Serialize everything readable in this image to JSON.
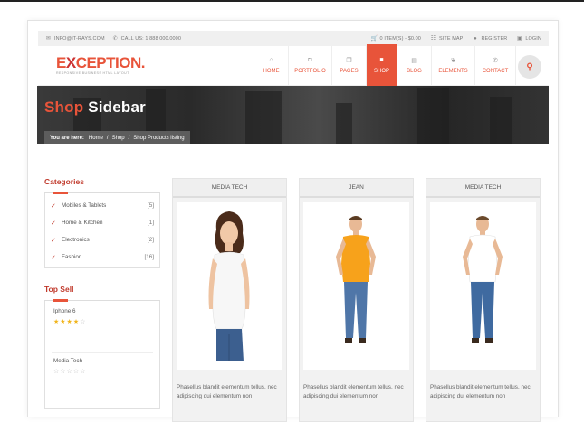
{
  "topbar": {
    "email": "INFO@IT-RAYS.COM",
    "phone": "CALL US: 1 888 000.0000",
    "cart": "0 ITEM(S) - $0.00",
    "sitemap": "SITE MAP",
    "register": "REGISTER",
    "login": "LOGIN"
  },
  "logo": {
    "name_a": "E",
    "name_x": "X",
    "name_b": "CEPTION.",
    "tagline": "RESPONSIVE BUSINESS HTML LAYOUT"
  },
  "nav": [
    {
      "label": "HOME",
      "icon": "home-icon",
      "glyph": "⌂"
    },
    {
      "label": "PORTFOLIO",
      "icon": "camera-icon",
      "glyph": "◘"
    },
    {
      "label": "PAGES",
      "icon": "copy-icon",
      "glyph": "❐"
    },
    {
      "label": "SHOP",
      "icon": "briefcase-icon",
      "glyph": "■"
    },
    {
      "label": "BLOG",
      "icon": "book-icon",
      "glyph": "▤"
    },
    {
      "label": "ELEMENTS",
      "icon": "leaf-icon",
      "glyph": "❦"
    },
    {
      "label": "CONTACT",
      "icon": "phone-icon",
      "glyph": "✆"
    }
  ],
  "hero": {
    "title_a": "Shop",
    "title_b": " Sidebar"
  },
  "breadcrumb": {
    "lead": "You are here:",
    "items": [
      "Home",
      "Shop",
      "Shop Products listing"
    ]
  },
  "categories": {
    "title": "Categories",
    "items": [
      {
        "label": "Mobiles & Tablets",
        "count": "[5]"
      },
      {
        "label": "Home & Kitchen",
        "count": "[1]"
      },
      {
        "label": "Electronics",
        "count": "[2]"
      },
      {
        "label": "Fashion",
        "count": "[16]"
      }
    ]
  },
  "topsell": {
    "title": "Top Sell",
    "items": [
      {
        "name": "Iphone 6",
        "rating": 4
      },
      {
        "name": "Media Tech",
        "rating": 0
      }
    ]
  },
  "products": [
    {
      "category": "MEDIA TECH",
      "desc": "Phasellus blandit elementum tellus, nec adipiscing dui elementum non",
      "shirt": "#ffffff",
      "model": "woman"
    },
    {
      "category": "JEAN",
      "desc": "Phasellus blandit elementum tellus, nec adipiscing dui elementum non",
      "shirt": "#f7a21b",
      "model": "man"
    },
    {
      "category": "MEDIA TECH",
      "desc": "Phasellus blandit elementum tellus, nec adipiscing dui elementum non",
      "shirt": "#ffffff",
      "model": "man"
    }
  ],
  "colors": {
    "accent": "#e8543a"
  }
}
